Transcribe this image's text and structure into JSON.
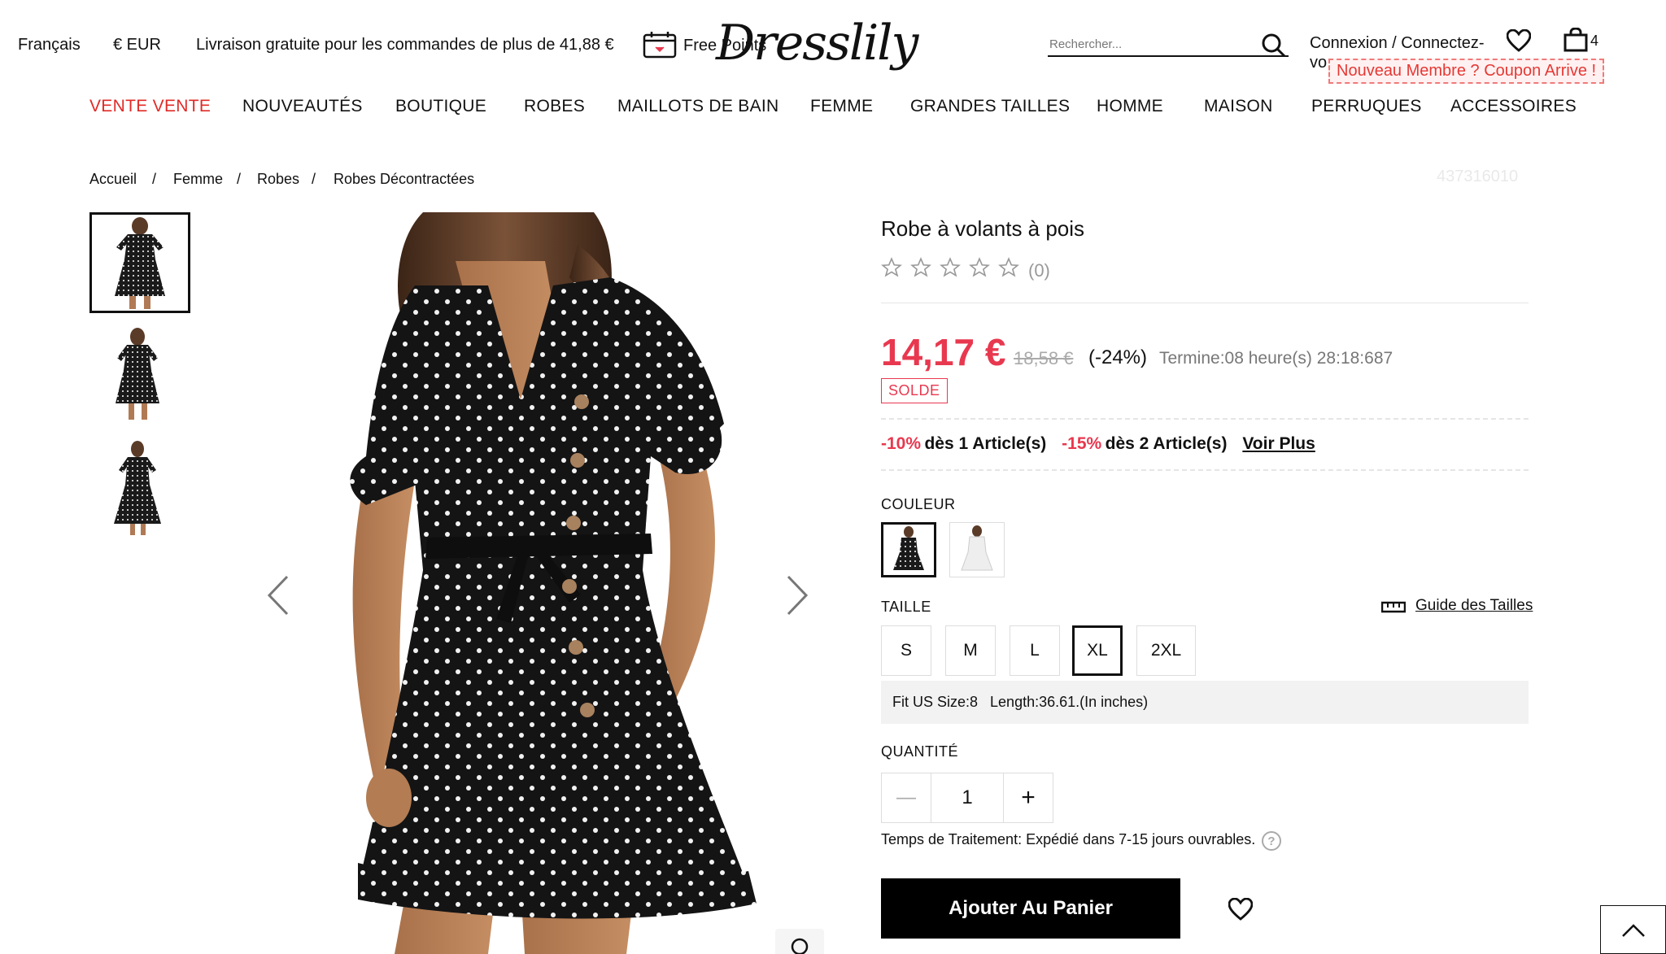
{
  "topbar": {
    "language": "Français",
    "currency": "€ EUR",
    "shipping": "Livraison gratuite pour les commandes de plus de 41,88 €",
    "free_points": "Free Points",
    "logo": "Dresslily",
    "search_placeholder": "Rechercher...",
    "login": "Connexion / Connectez-",
    "login_cont": "vo",
    "coupon": "Nouveau Membre ? Coupon Arrive !",
    "cart_count": "4"
  },
  "nav": [
    {
      "label": "VENTE VENTE",
      "active": true
    },
    {
      "label": "NOUVEAUTÉS"
    },
    {
      "label": "BOUTIQUE"
    },
    {
      "label": "ROBES"
    },
    {
      "label": "MAILLOTS DE BAIN"
    },
    {
      "label": "FEMME"
    },
    {
      "label": "GRANDES TAILLES"
    },
    {
      "label": "HOMME"
    },
    {
      "label": "MAISON"
    },
    {
      "label": "PERRUQUES"
    },
    {
      "label": "ACCESSOIRES"
    }
  ],
  "breadcrumb": [
    "Accueil",
    "Femme",
    "Robes",
    "Robes Décontractées"
  ],
  "breadcrumb_sep": "/",
  "sku": "437316010",
  "product": {
    "title": "Robe à volants à pois",
    "rating_count": "(0)",
    "price": "14,17 €",
    "old_price": "18,58 €",
    "discount": "(-24%)",
    "timer": "Termine:08 heure(s) 28:18:687",
    "badge": "SOLDE",
    "promo1_pct": "-10%",
    "promo1_text": "dès 1 Article(s)",
    "promo2_pct": "-15%",
    "promo2_text": "dès 2 Article(s)",
    "voir_plus": "Voir Plus",
    "color_label": "COULEUR",
    "size_label": "TAILLE",
    "size_guide": "Guide des Tailles",
    "sizes": [
      "S",
      "M",
      "L",
      "XL",
      "2XL"
    ],
    "selected_size": "XL",
    "fit_info": "Fit US Size:8   Length:36.61.(In inches)",
    "qty_label": "QUANTITÉ",
    "qty_value": "1",
    "qty_minus": "—",
    "qty_plus": "+",
    "processing": "Temps de Traitement: Expédié dans 7-15 jours ouvrables.",
    "add_to_cart": "Ajouter Au Panier"
  },
  "colors": {
    "accent_red": "#e8384f",
    "nav_red": "#e02b27",
    "black": "#000000"
  }
}
